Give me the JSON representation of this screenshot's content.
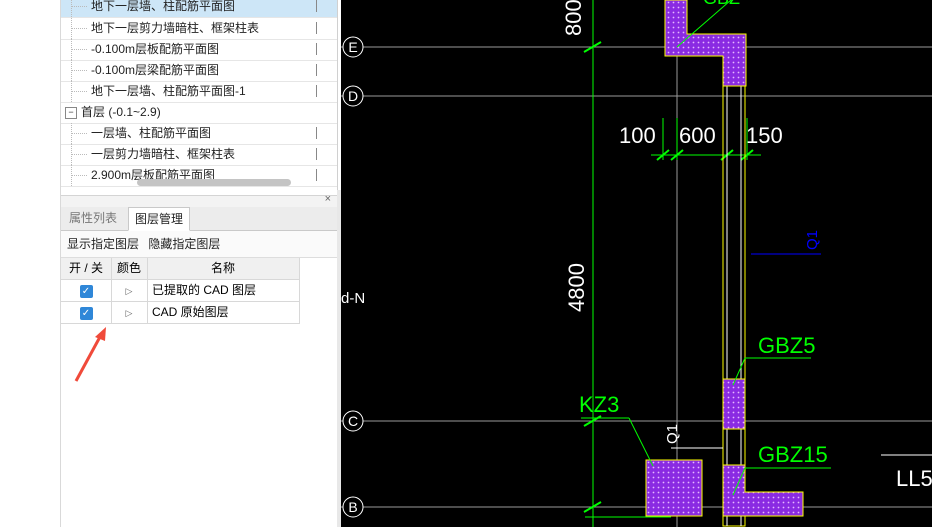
{
  "drawing_list": {
    "items": [
      {
        "label": "地下一层墙、柱配筋平面图",
        "selected": true
      },
      {
        "label": "地下一层剪力墙暗柱、框架柱表"
      },
      {
        "label": "-0.100m层板配筋平面图"
      },
      {
        "label": "-0.100m层梁配筋平面图"
      },
      {
        "label": "地下一层墙、柱配筋平面图-1"
      }
    ],
    "group": {
      "toggle": "−",
      "label": "首层 (-0.1~2.9)"
    },
    "group_items": [
      {
        "label": "一层墙、柱配筋平面图"
      },
      {
        "label": "一层剪力墙暗柱、框架柱表"
      },
      {
        "label": "2.900m层板配筋平面图"
      }
    ]
  },
  "panel": {
    "close": "×",
    "tabs": [
      {
        "label": "属性列表"
      },
      {
        "label": "图层管理"
      }
    ],
    "toolbar": {
      "show_layers": "显示指定图层",
      "hide_layers": "隐藏指定图层"
    },
    "columns": {
      "toggle": "开 / 关",
      "color": "颜色",
      "name": "名称"
    },
    "layers": [
      {
        "name": "已提取的 CAD 图层",
        "check": "✓",
        "swatch": "▷"
      },
      {
        "name": "CAD 原始图层",
        "check": "✓",
        "swatch": "▷"
      }
    ]
  },
  "cad": {
    "axes": [
      {
        "label": "E"
      },
      {
        "label": "D"
      },
      {
        "label": "C"
      },
      {
        "label": "B"
      }
    ],
    "side_label": "d-N",
    "dims": {
      "top": "800",
      "left": "4800",
      "d100": "100",
      "d600": "600",
      "d150": "150"
    },
    "tags": {
      "kz3": "KZ3",
      "gbz5": "GBZ5",
      "gbz15": "GBZ15",
      "q1": "Q1",
      "ll5": "LL5",
      "gbz_top": "GBZ"
    },
    "colors": {
      "axis": "#00d0ff",
      "dim": "#00ff00",
      "column": "#8a2be2",
      "wall": "#ffff00"
    }
  },
  "annotation": {
    "arrow_color": "#f04a3a"
  }
}
